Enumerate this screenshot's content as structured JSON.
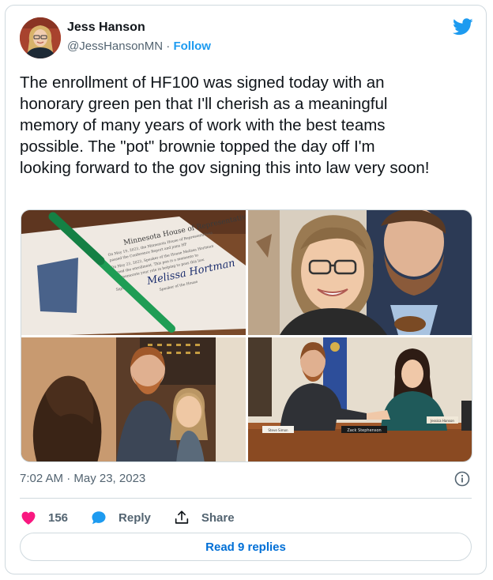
{
  "author": {
    "name": "Jess Hanson",
    "handle": "@JessHansonMN",
    "separator": "·",
    "follow_label": "Follow"
  },
  "tweet": {
    "text": "The enrollment of HF100 was signed today with an\nhonorary green pen that I'll cherish as a meaningful\nmemory of many years of work with the best teams\npossible. The \"pot\" brownie topped the day off        I'm\nlooking forward to the gov signing this into law very soon!",
    "timestamp": "7:02 AM · May 23, 2023"
  },
  "media": {
    "photo1": {
      "title": "Minnesota House of Representatives",
      "lines": [
        "On May 19, 2023, the Minnesota House of Representatives",
        "passed the Conference Report and joins HF",
        "On May 23, 2023, Speaker of the House Melissa Hortman",
        "signed the enrollment. This pen is a memento to",
        "commemorate your role in helping to pass this law."
      ],
      "signed_label": "Signed",
      "signature": "Melissa Hortman",
      "speaker_caption": "Speaker of the House"
    },
    "photo4": {
      "nameplate_left": "Steve Simon",
      "nameplate_center": "Zack Stephenson",
      "nameplate_right": "Jessica Hanson"
    }
  },
  "actions": {
    "like_count": "156",
    "reply_label": "Reply",
    "share_label": "Share",
    "read_replies_label": "Read 9 replies"
  },
  "colors": {
    "accent": "#1d9bf0",
    "like": "#f91880",
    "reply_icon": "#1d9bf0",
    "text": "#0f1419",
    "muted": "#536471"
  }
}
